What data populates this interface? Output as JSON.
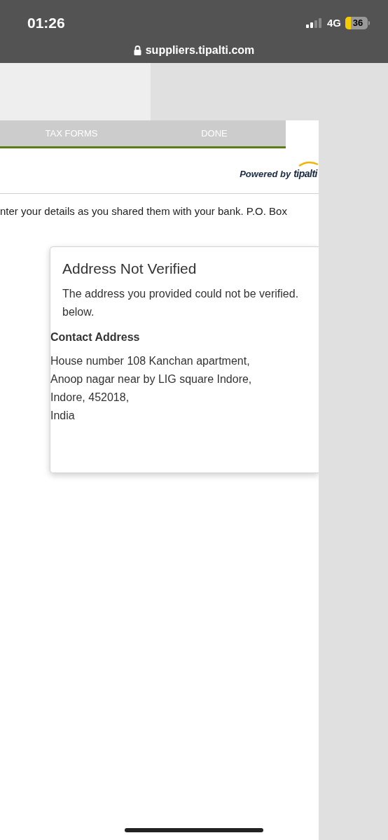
{
  "status_bar": {
    "time": "01:26",
    "network": "4G",
    "battery": "36"
  },
  "address_bar": {
    "url": "suppliers.tipalti.com"
  },
  "steps": [
    {
      "label": "TAX FORMS"
    },
    {
      "label": "DONE"
    }
  ],
  "branding": {
    "prefix": "Powered by",
    "brand": "tipalti"
  },
  "instructions": "nter your details as you shared them with your bank. P.O. Box",
  "dialog": {
    "title": "Address Not Verified",
    "message_lines": [
      "The address you provided could not be verified.",
      "below."
    ],
    "section_title": "Contact Address",
    "address_lines": [
      "House number 108 Kanchan apartment,",
      "Anoop nagar near by LIG square Indore,",
      "Indore, 452018,",
      "India"
    ]
  }
}
